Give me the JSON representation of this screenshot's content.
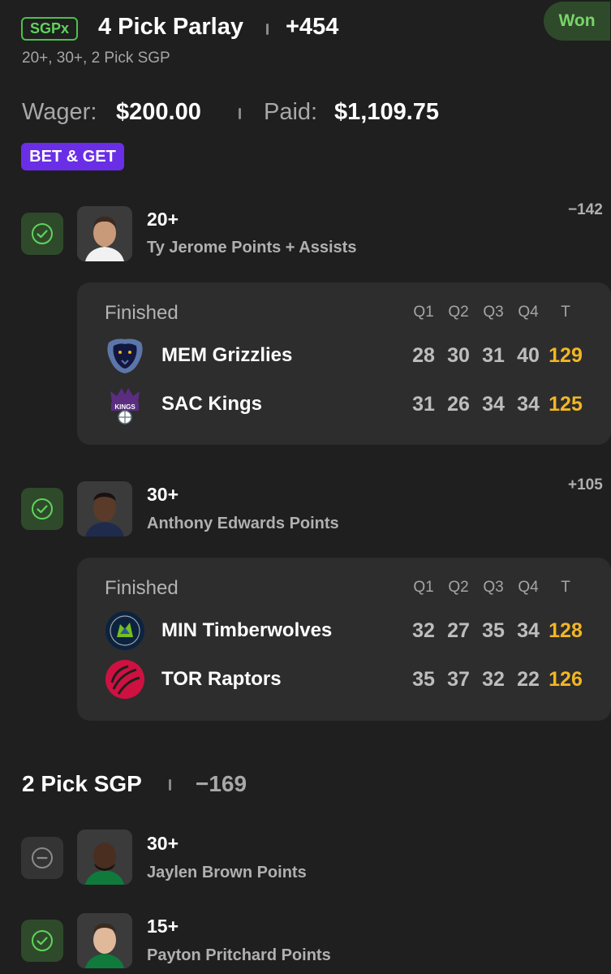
{
  "header": {
    "badge": "SGPx",
    "title": "4 Pick Parlay",
    "odds": "+454",
    "subtitle": "20+, 30+, 2 Pick SGP",
    "status": "Won"
  },
  "wager": {
    "wager_label": "Wager:",
    "wager_value": "$200.00",
    "paid_label": "Paid:",
    "paid_value": "$1,109.75",
    "promo": "BET & GET"
  },
  "legs": [
    {
      "line": "20+",
      "desc": "Ty Jerome Points + Assists",
      "odds": "−142",
      "status": "won"
    },
    {
      "line": "30+",
      "desc": "Anthony Edwards Points",
      "odds": "+105",
      "status": "won"
    }
  ],
  "games": [
    {
      "state": "Finished",
      "headers": [
        "Q1",
        "Q2",
        "Q3",
        "Q4",
        "T"
      ],
      "teams": [
        {
          "name": "MEM Grizzlies",
          "q": [
            "28",
            "30",
            "31",
            "40"
          ],
          "t": "129"
        },
        {
          "name": "SAC Kings",
          "q": [
            "31",
            "26",
            "34",
            "34"
          ],
          "t": "125"
        }
      ]
    },
    {
      "state": "Finished",
      "headers": [
        "Q1",
        "Q2",
        "Q3",
        "Q4",
        "T"
      ],
      "teams": [
        {
          "name": "MIN Timberwolves",
          "q": [
            "32",
            "27",
            "35",
            "34"
          ],
          "t": "128"
        },
        {
          "name": "TOR Raptors",
          "q": [
            "35",
            "37",
            "32",
            "22"
          ],
          "t": "126"
        }
      ]
    }
  ],
  "sgp": {
    "title": "2 Pick SGP",
    "odds": "−169",
    "legs": [
      {
        "line": "30+",
        "desc": "Jaylen Brown Points",
        "status": "push"
      },
      {
        "line": "15+",
        "desc": "Payton Pritchard Points",
        "status": "won"
      }
    ]
  },
  "colors": {
    "background": "#1f1f1f",
    "win_green": "#5fd35c",
    "total_gold": "#f2b624",
    "promo_purple": "#6a2ee6"
  },
  "icons": [
    "check-circle-icon",
    "minus-circle-icon",
    "grizzlies-logo",
    "kings-logo",
    "timberwolves-logo",
    "raptors-logo"
  ]
}
